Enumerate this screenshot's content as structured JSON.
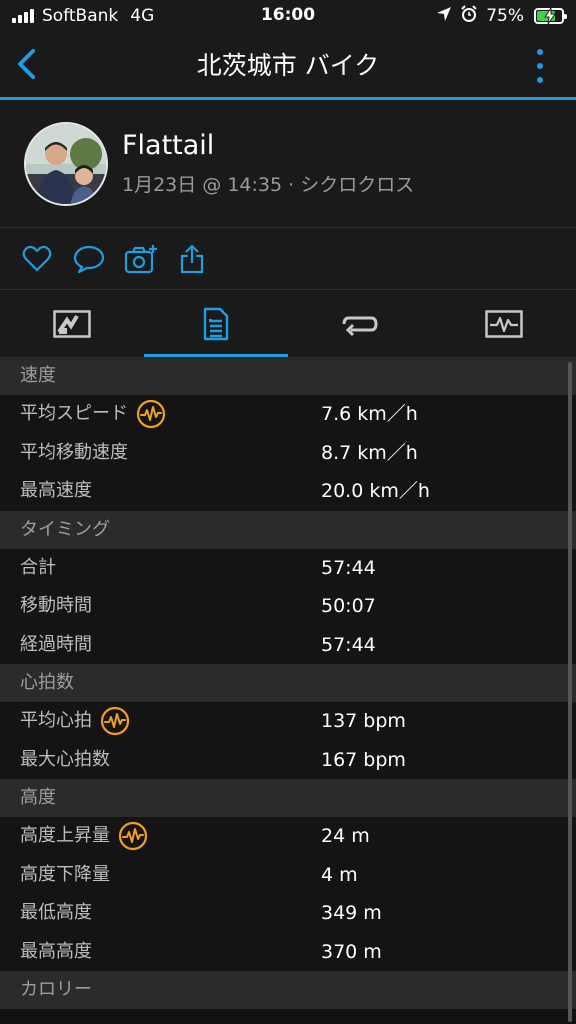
{
  "status_bar": {
    "carrier": "SoftBank",
    "network": "4G",
    "time": "16:00",
    "battery_percent": "75%",
    "battery_level": 0.75,
    "icons": [
      "signal-icon",
      "location-arrow-icon",
      "alarm-icon",
      "battery-charging-icon"
    ]
  },
  "nav": {
    "title": "北茨城市 バイク",
    "back_icon": "chevron-left-icon",
    "more_icon": "more-vertical-icon"
  },
  "profile": {
    "name": "Flattail",
    "meta": "1月23日 @ 14:35 · シクロクロス"
  },
  "actions": [
    "heart-icon",
    "comment-icon",
    "camera-add-icon",
    "share-icon"
  ],
  "tabs": [
    {
      "icon": "map-overview-icon",
      "active": false
    },
    {
      "icon": "stats-list-icon",
      "active": true
    },
    {
      "icon": "laps-icon",
      "active": false
    },
    {
      "icon": "chart-icon",
      "active": false
    }
  ],
  "accent_color": "#1e9de0",
  "hr_icon_color": "#f0a020",
  "sections": [
    {
      "title": "速度",
      "rows": [
        {
          "label": "平均スピード",
          "value": "7.6 km／h",
          "hr_icon": true
        },
        {
          "label": "平均移動速度",
          "value": "8.7 km／h",
          "hr_icon": false
        },
        {
          "label": "最高速度",
          "value": "20.0 km／h",
          "hr_icon": false
        }
      ]
    },
    {
      "title": "タイミング",
      "rows": [
        {
          "label": "合計",
          "value": "57:44",
          "hr_icon": false
        },
        {
          "label": "移動時間",
          "value": "50:07",
          "hr_icon": false
        },
        {
          "label": "経過時間",
          "value": "57:44",
          "hr_icon": false
        }
      ]
    },
    {
      "title": "心拍数",
      "rows": [
        {
          "label": "平均心拍",
          "value": "137 bpm",
          "hr_icon": true
        },
        {
          "label": "最大心拍数",
          "value": "167 bpm",
          "hr_icon": false
        }
      ]
    },
    {
      "title": "高度",
      "rows": [
        {
          "label": "高度上昇量",
          "value": "24 m",
          "hr_icon": true
        },
        {
          "label": "高度下降量",
          "value": "4 m",
          "hr_icon": false
        },
        {
          "label": "最低高度",
          "value": "349 m",
          "hr_icon": false
        },
        {
          "label": "最高高度",
          "value": "370 m",
          "hr_icon": false
        }
      ]
    },
    {
      "title": "カロリー",
      "rows": []
    }
  ]
}
